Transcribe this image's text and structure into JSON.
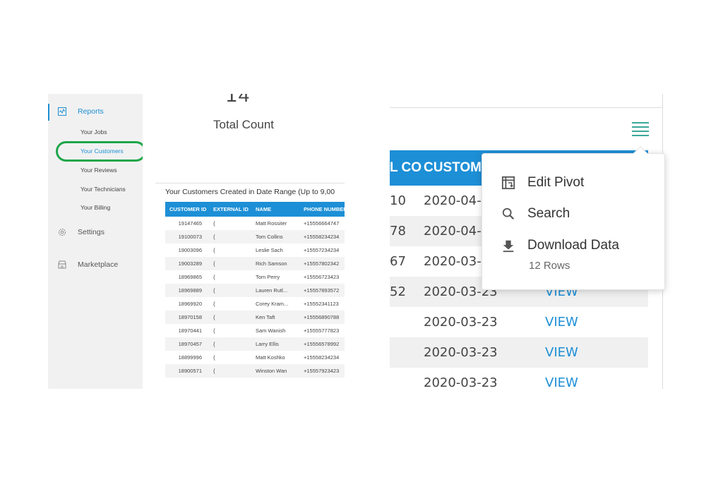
{
  "sidebar": {
    "reports": "Reports",
    "sub_items": [
      "Your Jobs",
      "Your Customers",
      "Your Reviews",
      "Your Technicians",
      "Your Billing"
    ],
    "settings": "Settings",
    "marketplace": "Marketplace"
  },
  "summary": {
    "count": "14",
    "label": "Total Count"
  },
  "customers_table": {
    "title": "Your Customers Created in Date Range (Up to 9,00",
    "headers": [
      "CUSTOMER ID",
      "EXTERNAL ID",
      "NAME",
      "PHONE NUMBER"
    ],
    "rows": [
      [
        "19147465",
        "{",
        "Matt Rossiter",
        "+15556664747"
      ],
      [
        "19100073",
        "{",
        "Tom Collins",
        "+15558234234"
      ],
      [
        "19003096",
        "{",
        "Leslie Sach",
        "+15557234234"
      ],
      [
        "19003289",
        "{",
        "Rich Samson",
        "+15557802342"
      ],
      [
        "18969865",
        "{",
        "Tom Perry",
        "+15556723423"
      ],
      [
        "18969889",
        "{",
        "Lauren Rutl...",
        "+15557893572"
      ],
      [
        "18969920",
        "{",
        "Corey Kram...",
        "+15552341123"
      ],
      [
        "18970158",
        "{",
        "Ken Taft",
        "+15556890788"
      ],
      [
        "18970441",
        "{",
        "Sam Wanish",
        "+15555777823"
      ],
      [
        "18970457",
        "{",
        "Larry Ellis",
        "+15556578992"
      ],
      [
        "18899996",
        "{",
        "Matt Koshko",
        "+15558234234"
      ],
      [
        "18900571",
        "{",
        "Winston Wan",
        "+15557923423"
      ]
    ]
  },
  "zoom_table": {
    "headers": [
      "L CO",
      "CUSTOM",
      ""
    ],
    "rows": [
      [
        "10",
        "2020-04-",
        ""
      ],
      [
        "78",
        "2020-04-",
        ""
      ],
      [
        "67",
        "2020-03-",
        ""
      ],
      [
        "52",
        "2020-03-23",
        "VIEW"
      ],
      [
        "",
        "2020-03-23",
        "VIEW"
      ],
      [
        "",
        "2020-03-23",
        "VIEW"
      ],
      [
        "",
        "2020-03-23",
        "VIEW"
      ]
    ]
  },
  "menu": {
    "edit_pivot": "Edit Pivot",
    "search": "Search",
    "download": "Download Data",
    "rows": "12 Rows"
  },
  "colors": {
    "accent": "#1d8fd6",
    "highlight": "#1ea64a",
    "menu_icon": "#3aa89a"
  }
}
